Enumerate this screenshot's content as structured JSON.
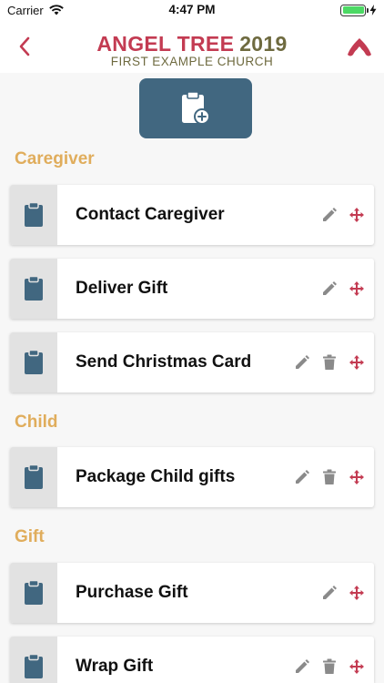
{
  "status": {
    "carrier": "Carrier",
    "time": "4:47 PM"
  },
  "header": {
    "title": "ANGEL TREE",
    "year": "2019",
    "subtitle": "FIRST EXAMPLE CHURCH"
  },
  "colors": {
    "brand_red": "#c33b52",
    "olive": "#6e6a3f",
    "section_gold": "#e0ad5c",
    "primary_blue": "#416780",
    "icon_box_gray": "#e2e2e2"
  },
  "sections": [
    {
      "label": "Caregiver",
      "tasks": [
        {
          "title": "Contact Caregiver",
          "deletable": false
        },
        {
          "title": "Deliver Gift",
          "deletable": false
        },
        {
          "title": "Send Christmas Card",
          "deletable": true
        }
      ]
    },
    {
      "label": "Child",
      "tasks": [
        {
          "title": "Package Child gifts",
          "deletable": true
        }
      ]
    },
    {
      "label": "Gift",
      "tasks": [
        {
          "title": "Purchase Gift",
          "deletable": false
        },
        {
          "title": "Wrap Gift",
          "deletable": true
        }
      ]
    }
  ]
}
